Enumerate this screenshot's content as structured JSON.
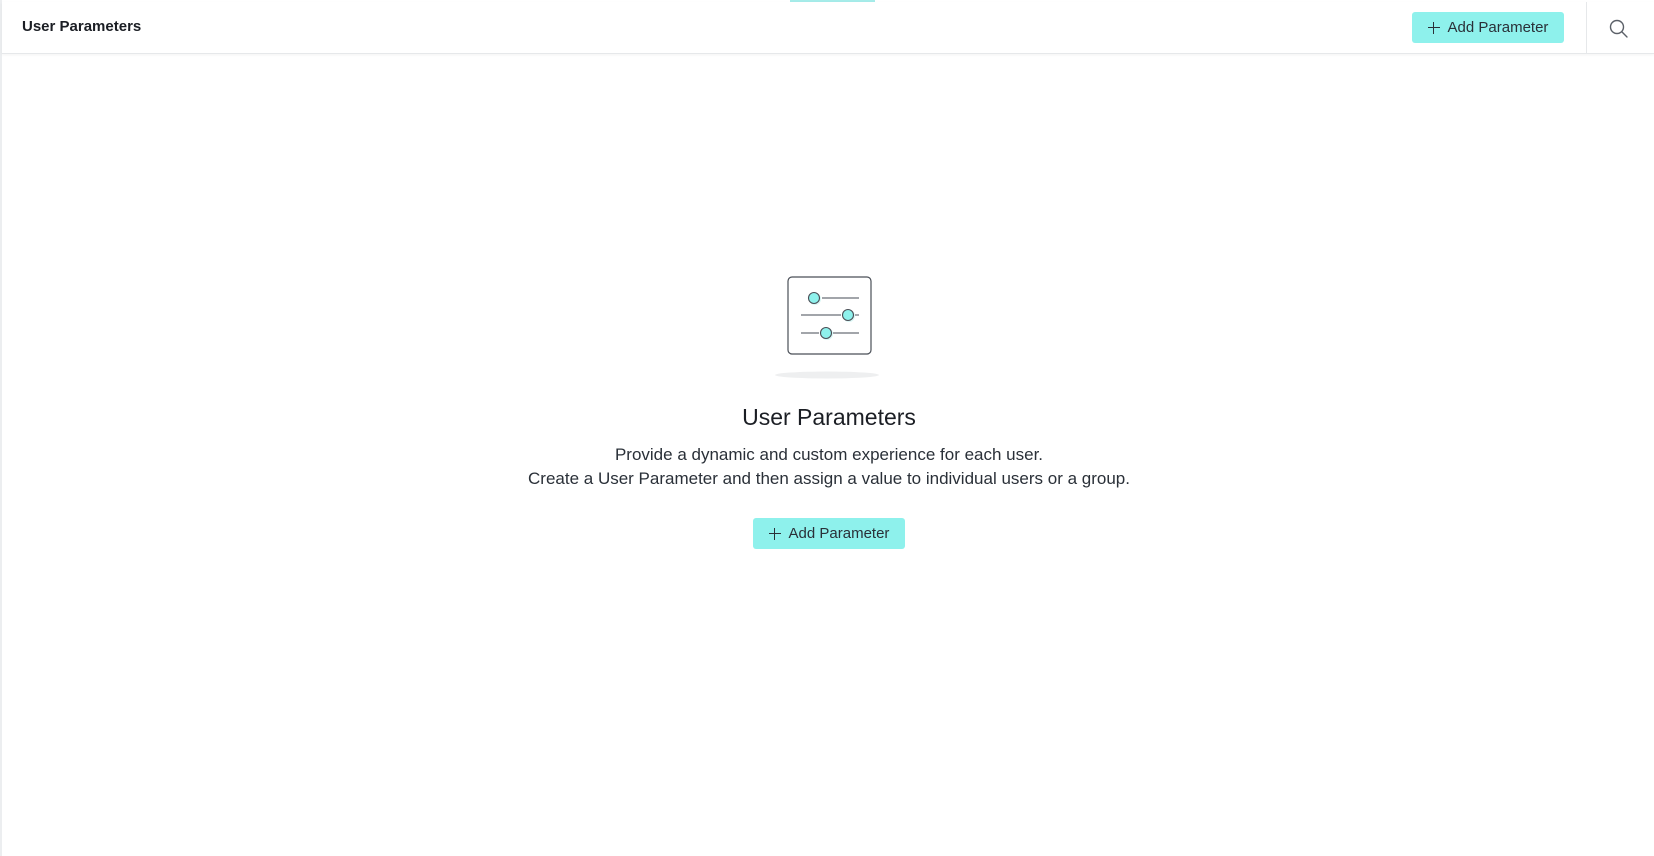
{
  "header": {
    "title": "User Parameters",
    "add_button_label": "Add Parameter",
    "search_icon": "search-icon"
  },
  "empty_state": {
    "illustration_icon": "sliders-icon",
    "title": "User Parameters",
    "description_line1": "Provide a dynamic and custom experience for each user.",
    "description_line2": "Create a User Parameter and then assign a value to individual users or a group.",
    "add_button_label": "Add Parameter"
  },
  "colors": {
    "accent": "#8ef1ec",
    "accent_border": "#a6ece9",
    "text": "#1b1e24"
  }
}
